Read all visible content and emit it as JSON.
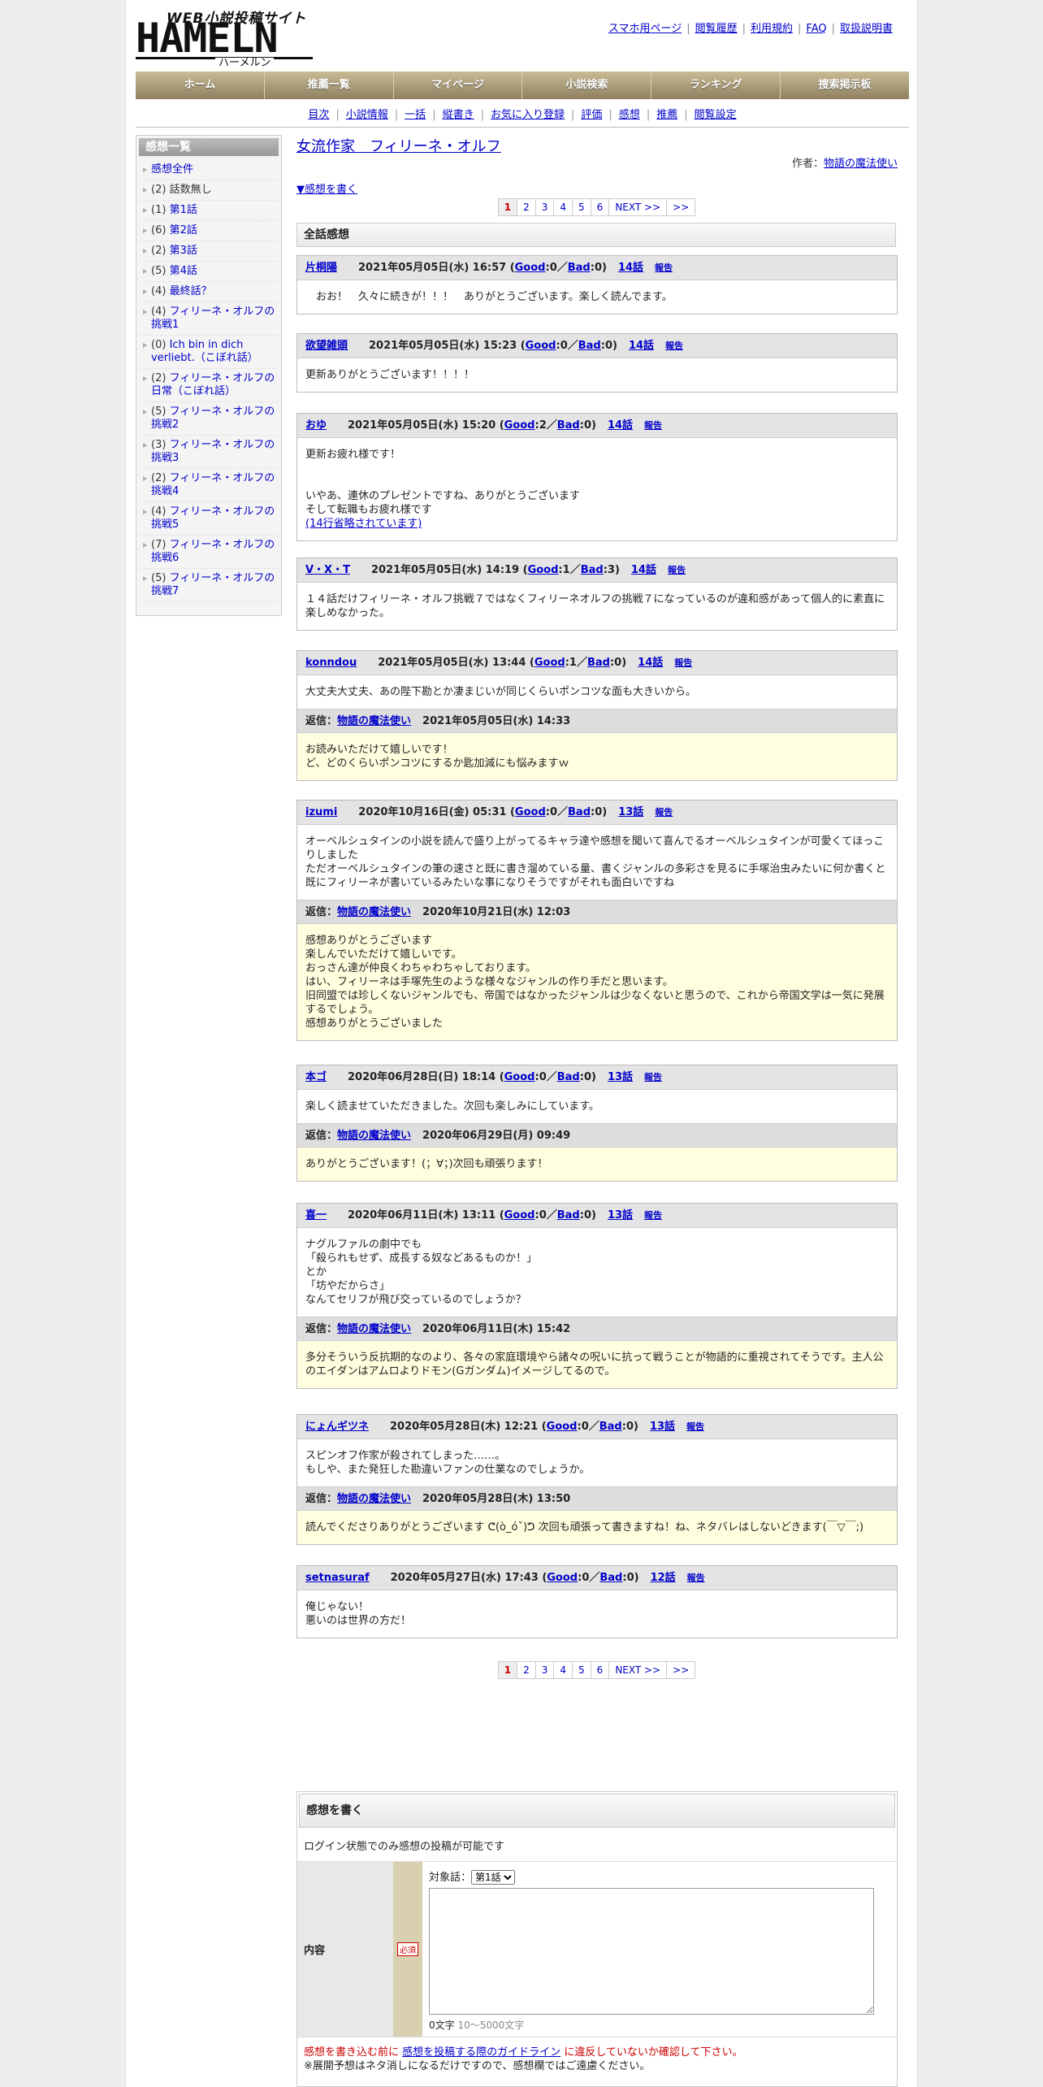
{
  "logo": {
    "sub": "WEB小説投稿サイト",
    "main": "HAMELN",
    "kana": "ハーメルン"
  },
  "toplinks": [
    "スマホ用ページ",
    "閲覧履歴",
    "利用規約",
    "FAQ",
    "取扱説明書"
  ],
  "gnav": [
    "ホーム",
    "推薦一覧",
    "マイページ",
    "小説検索",
    "ランキング",
    "捜索掲示板"
  ],
  "subnav": [
    "目次",
    "小説情報",
    "一括",
    "縦書き",
    "お気に入り登録",
    "評価",
    "感想",
    "推薦",
    "閲覧設定"
  ],
  "sidebar": {
    "title": "感想一覧",
    "items": [
      {
        "count": "",
        "label": "感想全件"
      },
      {
        "count": "(2)",
        "label": "話数無し"
      },
      {
        "count": "(1)",
        "label": "第1話"
      },
      {
        "count": "(6)",
        "label": "第2話"
      },
      {
        "count": "(2)",
        "label": "第3話"
      },
      {
        "count": "(5)",
        "label": "第4話"
      },
      {
        "count": "(4)",
        "label": "最終話？"
      },
      {
        "count": "(4)",
        "label": "フィリーネ・オルフの挑戦1"
      },
      {
        "count": "(0)",
        "label": "Ich bin in dich verliebt.（こぼれ話）"
      },
      {
        "count": "(2)",
        "label": "フィリーネ・オルフの日常（こぼれ話）"
      },
      {
        "count": "(5)",
        "label": "フィリーネ・オルフの挑戦2"
      },
      {
        "count": "(3)",
        "label": "フィリーネ・オルフの挑戦3"
      },
      {
        "count": "(2)",
        "label": "フィリーネ・オルフの挑戦4"
      },
      {
        "count": "(4)",
        "label": "フィリーネ・オルフの挑戦5"
      },
      {
        "count": "(7)",
        "label": "フィリーネ・オルフの挑戦6"
      },
      {
        "count": "(5)",
        "label": "フィリーネ・オルフの挑戦7"
      }
    ]
  },
  "novel": {
    "title": "女流作家　フィリーネ・オルフ",
    "author_label": "作者：",
    "author": "物語の魔法使い",
    "write_link": "▼感想を書く"
  },
  "pager": {
    "pages": [
      "1",
      "2",
      "3",
      "4",
      "5",
      "6"
    ],
    "current": "1",
    "next": "NEXT >>",
    "last": ">>"
  },
  "all_header": "全話感想",
  "labels": {
    "good": "Good",
    "bad": "Bad",
    "report": "報告",
    "reply_prefix": "返信："
  },
  "comments": [
    {
      "user": "片桐陽",
      "date": "2021年05月05日(水) 16:57",
      "good": "0",
      "bad": "0",
      "ep": "14話",
      "body": "　おお！　久々に続きが！！！　ありがとうございます。楽しく読んでます。"
    },
    {
      "user": "欲望雑頭",
      "date": "2021年05月05日(水) 15:23",
      "good": "0",
      "bad": "0",
      "ep": "14話",
      "body": "更新ありがとうございます！！！！"
    },
    {
      "user": "おゆ",
      "date": "2021年05月05日(水) 15:20",
      "good": "2",
      "bad": "0",
      "ep": "14話",
      "body": "更新お疲れ様です！\n\n\nいやあ、連休のプレゼントですね、ありがとうございます\nそして転職もお疲れ様です",
      "omit": "(14行省略されています)"
    },
    {
      "user": "V・X・T",
      "date": "2021年05月05日(水) 14:19",
      "good": "1",
      "bad": "3",
      "ep": "14話",
      "body": "１４話だけフィリーネ・オルフ挑戦７ではなくフィリーネオルフの挑戦７になっているのが違和感があって個人的に素直に楽しめなかった。"
    },
    {
      "user": "konndou",
      "date": "2021年05月05日(水) 13:44",
      "good": "1",
      "bad": "0",
      "ep": "14話",
      "body": "大丈夫大丈夫、あの陛下勘とか凄まじいが同じくらいポンコツな面も大きいから。",
      "reply_user": "物語の魔法使い",
      "reply_date": "2021年05月05日(水) 14:33",
      "reply": "お読みいただけて嬉しいです！\nど、どのくらいポンコツにするか匙加減にも悩みますｗ"
    },
    {
      "user": "izumi",
      "date": "2020年10月16日(金) 05:31",
      "good": "0",
      "bad": "0",
      "ep": "13話",
      "body": "オーベルシュタインの小説を読んで盛り上がってるキャラ達や感想を聞いて喜んでるオーベルシュタインが可愛くてほっこりしました\nただオーベルシュタインの筆の速さと既に書き溜めている量、書くジャンルの多彩さを見るに手塚治虫みたいに何か書くと既にフィリーネが書いているみたいな事になりそうですがそれも面白いですね",
      "reply_user": "物語の魔法使い",
      "reply_date": "2020年10月21日(水) 12:03",
      "reply": "感想ありがとうございます\n楽しんでいただけて嬉しいです。\nおっさん達が仲良くわちゃわちゃしております。\nはい、フィリーネは手塚先生のような様々なジャンルの作り手だと思います。\n旧同盟では珍しくないジャンルでも、帝国ではなかったジャンルは少なくないと思うので、これから帝国文学は一気に発展するでしょう。\n感想ありがとうございました"
    },
    {
      "user": "本ゴ",
      "date": "2020年06月28日(日) 18:14",
      "good": "0",
      "bad": "0",
      "ep": "13話",
      "body": "楽しく読ませていただきました。次回も楽しみにしています。",
      "reply_user": "物語の魔法使い",
      "reply_date": "2020年06月29日(月) 09:49",
      "reply": "ありがとうございます！(；∀；)次回も頑張ります！"
    },
    {
      "user": "喜一",
      "date": "2020年06月11日(木) 13:11",
      "good": "0",
      "bad": "0",
      "ep": "13話",
      "body": "ナグルファルの劇中でも\n「殺られもせず、成長する奴などあるものか！」\nとか\n「坊やだからさ」\nなんてセリフが飛び交っているのでしょうか？",
      "reply_user": "物語の魔法使い",
      "reply_date": "2020年06月11日(木) 15:42",
      "reply": "多分そういう反抗期的なのより、各々の家庭環境やら諸々の呪いに抗って戦うことが物語的に重視されてそうです。主人公のエイダンはアムロよりドモン(Gガンダム)イメージしてるので。"
    },
    {
      "user": "にょんギツネ",
      "date": "2020年05月28日(木) 12:21",
      "good": "0",
      "bad": "0",
      "ep": "13話",
      "body": "スピンオフ作家が殺されてしまった……。\nもしや、また発狂した勘違いファンの仕業なのでしょうか。",
      "reply_user": "物語の魔法使い",
      "reply_date": "2020年05月28日(木) 13:50",
      "reply": "読んでくださりありがとうございます ᕦ(ò_óˇ)ᕤ 次回も頑張って書きますね！ね、ネタバレはしないどきます(￣▽￣;)"
    },
    {
      "user": "setnasuraf",
      "date": "2020年05月27日(水) 17:43",
      "good": "0",
      "bad": "0",
      "ep": "12話",
      "body": "俺じゃない！\n悪いのは世界の方だ！"
    }
  ],
  "form": {
    "title": "感想を書く",
    "note": "ログイン状態でのみ感想の投稿が可能です",
    "content_label": "内容",
    "required": "必須",
    "target_label": "対象話：",
    "target_value": "第1話",
    "count": "0文字",
    "count_range": "10～5000文字",
    "warn_pre": "感想を書き込む前に",
    "warn_link": "感想を投稿する際のガイドライン",
    "warn_post": "に違反していないか確認して下さい。",
    "warn2": "※展開予想はネタ消しになるだけですので、感想欄ではご遠慮ください。"
  }
}
